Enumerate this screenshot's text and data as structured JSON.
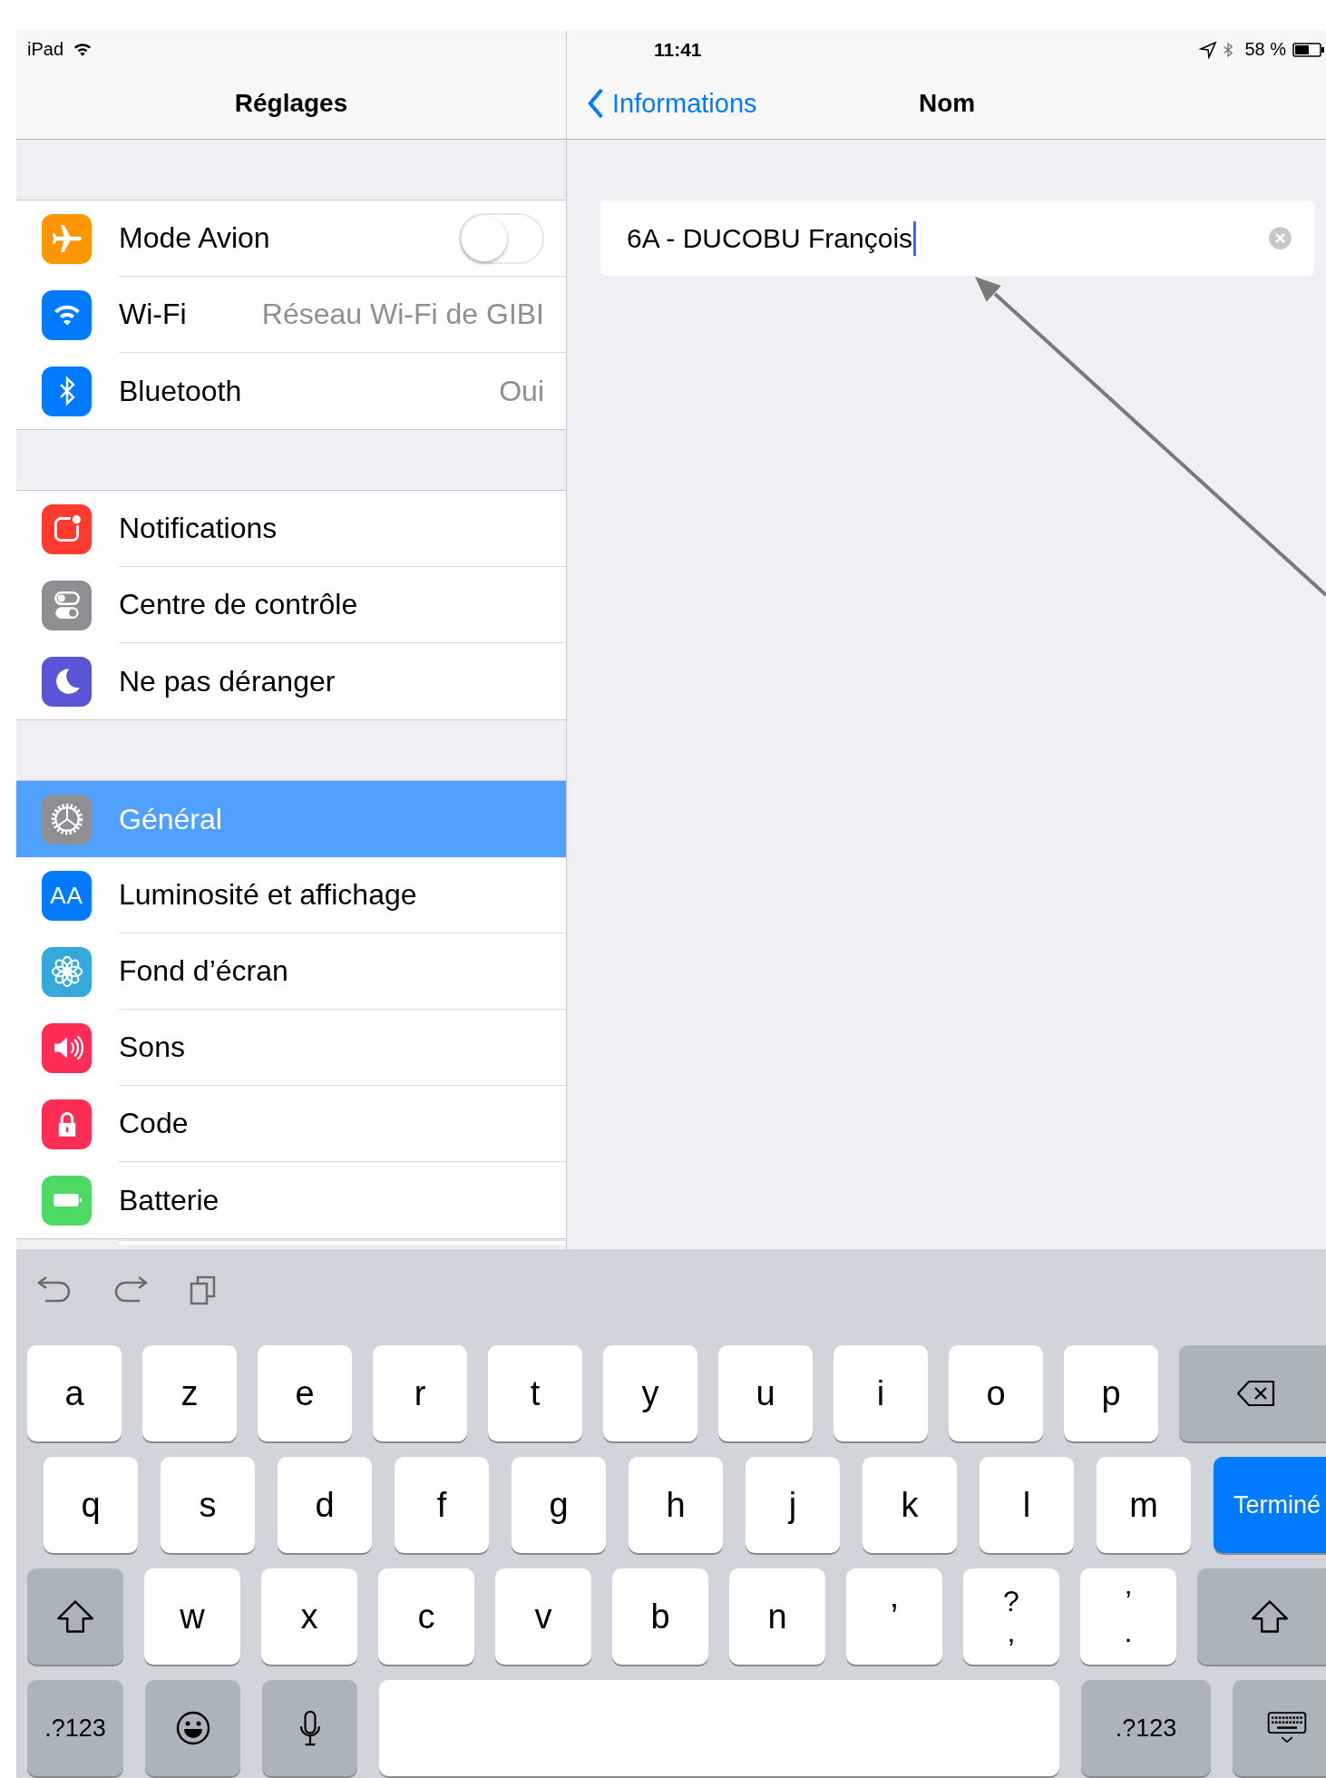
{
  "status_bar": {
    "device": "iPad",
    "time": "11:41",
    "battery": "58 %"
  },
  "sidebar": {
    "title": "Réglages",
    "groups": [
      {
        "items": [
          {
            "label": "Mode Avion",
            "color": "#ff9500",
            "kind": "toggle",
            "on": false,
            "selected": false
          },
          {
            "label": "Wi-Fi",
            "color": "#007aff",
            "kind": "value",
            "value": "Réseau Wi-Fi de GIBI",
            "selected": false
          },
          {
            "label": "Bluetooth",
            "color": "#007aff",
            "kind": "value",
            "value": "Oui",
            "selected": false
          }
        ]
      },
      {
        "items": [
          {
            "label": "Notifications",
            "color": "#ff3b30",
            "kind": "plain",
            "selected": false
          },
          {
            "label": "Centre de contrôle",
            "color": "#8e8e93",
            "kind": "plain",
            "selected": false
          },
          {
            "label": "Ne pas déranger",
            "color": "#5856d6",
            "kind": "plain",
            "selected": false
          }
        ]
      },
      {
        "items": [
          {
            "label": "Général",
            "color": "#8e8e93",
            "kind": "plain",
            "selected": true
          },
          {
            "label": "Luminosité et affichage",
            "icon_text": "AA",
            "color": "#007aff",
            "kind": "plain",
            "selected": false
          },
          {
            "label": "Fond d’écran",
            "color": "#34aadc",
            "kind": "plain",
            "selected": false
          },
          {
            "label": "Sons",
            "color": "#ff2d55",
            "kind": "plain",
            "selected": false
          },
          {
            "label": "Code",
            "color": "#ff2d55",
            "kind": "plain",
            "selected": false
          },
          {
            "label": "Batterie",
            "color": "#4cd964",
            "kind": "plain",
            "selected": false
          }
        ]
      }
    ]
  },
  "detail": {
    "back": "Informations",
    "title": "Nom",
    "field": {
      "value": "6A - DUCOBU François"
    }
  },
  "keyboard": {
    "rows": [
      {
        "keys": [
          {
            "kind": "letter",
            "label": "a"
          },
          {
            "kind": "letter",
            "label": "z"
          },
          {
            "kind": "letter",
            "label": "e"
          },
          {
            "kind": "letter",
            "label": "r"
          },
          {
            "kind": "letter",
            "label": "t"
          },
          {
            "kind": "letter",
            "label": "y"
          },
          {
            "kind": "letter",
            "label": "u"
          },
          {
            "kind": "letter",
            "label": "i"
          },
          {
            "kind": "letter",
            "label": "o"
          },
          {
            "kind": "letter",
            "label": "p"
          },
          {
            "kind": "backspace"
          }
        ]
      },
      {
        "keys": [
          {
            "kind": "letter",
            "label": "q"
          },
          {
            "kind": "letter",
            "label": "s"
          },
          {
            "kind": "letter",
            "label": "d"
          },
          {
            "kind": "letter",
            "label": "f"
          },
          {
            "kind": "letter",
            "label": "g"
          },
          {
            "kind": "letter",
            "label": "h"
          },
          {
            "kind": "letter",
            "label": "j"
          },
          {
            "kind": "letter",
            "label": "k"
          },
          {
            "kind": "letter",
            "label": "l"
          },
          {
            "kind": "letter",
            "label": "m"
          },
          {
            "kind": "done",
            "label": "Terminé"
          }
        ]
      },
      {
        "keys": [
          {
            "kind": "shift"
          },
          {
            "kind": "letter",
            "label": "w"
          },
          {
            "kind": "letter",
            "label": "x"
          },
          {
            "kind": "letter",
            "label": "c"
          },
          {
            "kind": "letter",
            "label": "v"
          },
          {
            "kind": "letter",
            "label": "b"
          },
          {
            "kind": "letter",
            "label": "n"
          },
          {
            "kind": "letter",
            "label": "’"
          },
          {
            "kind": "dual",
            "label": ",",
            "top": "?"
          },
          {
            "kind": "dual",
            "label": ".",
            "top": "’"
          },
          {
            "kind": "shift"
          }
        ]
      },
      {
        "keys": [
          {
            "kind": "mode",
            "label": ".?123"
          },
          {
            "kind": "emoji"
          },
          {
            "kind": "dictation"
          },
          {
            "kind": "space"
          },
          {
            "kind": "mode",
            "label": ".?123"
          },
          {
            "kind": "hide"
          }
        ]
      }
    ]
  }
}
